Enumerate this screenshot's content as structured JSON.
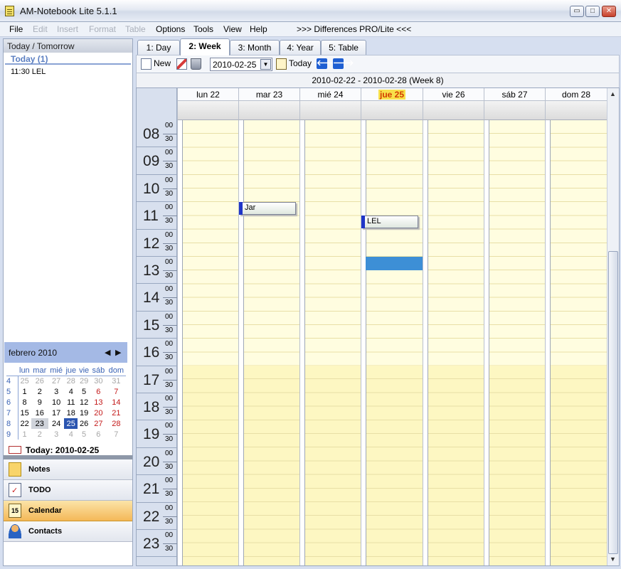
{
  "window": {
    "title": "AM-Notebook Lite  5.1.1",
    "minimize": "▭",
    "maximize": "□",
    "close": "✕"
  },
  "menu": [
    "File",
    "Edit",
    "Insert",
    "Format",
    "Table",
    "Options",
    "Tools",
    "View",
    "Help",
    ">>> Differences PRO/Lite <<<"
  ],
  "left": {
    "header": "Today / Tomorrow",
    "today_label": "Today (1)",
    "items": [
      "11:30 LEL"
    ],
    "minical": {
      "month": "febrero 2010",
      "prev": "◀",
      "next": "▶",
      "dow": [
        "lun",
        "mar",
        "mié",
        "jue",
        "vie",
        "sáb",
        "dom"
      ],
      "weeks": [
        {
          "wk": "4",
          "days": [
            "25",
            "26",
            "27",
            "28",
            "29",
            "30",
            "31"
          ]
        },
        {
          "wk": "5",
          "days": [
            "1",
            "2",
            "3",
            "4",
            "5",
            "6",
            "7"
          ]
        },
        {
          "wk": "6",
          "days": [
            "8",
            "9",
            "10",
            "11",
            "12",
            "13",
            "14"
          ]
        },
        {
          "wk": "7",
          "days": [
            "15",
            "16",
            "17",
            "18",
            "19",
            "20",
            "21"
          ]
        },
        {
          "wk": "8",
          "days": [
            "22",
            "23",
            "24",
            "25",
            "26",
            "27",
            "28"
          ]
        },
        {
          "wk": "9",
          "days": [
            "1",
            "2",
            "3",
            "4",
            "5",
            "6",
            "7"
          ]
        }
      ],
      "today_text": "Today: 2010-02-25"
    },
    "splitter_dots": "•••••",
    "nav": [
      {
        "label": "Notes",
        "icon": "notes-icon"
      },
      {
        "label": "TODO",
        "icon": "todo-icon"
      },
      {
        "label": "Calendar",
        "icon": "calendar-icon",
        "icon_text": "15"
      },
      {
        "label": "Contacts",
        "icon": "contacts-icon"
      }
    ]
  },
  "tabs": [
    "1: Day",
    "2: Week",
    "3: Month",
    "4: Year",
    "5: Table"
  ],
  "active_tab": "2: Week",
  "toolbar": {
    "new_label": "New",
    "date_value": "2010-02-25",
    "dropdown": "▼",
    "today_label": "Today",
    "prev": "🡐",
    "next": "🡒"
  },
  "week_title": "2010-02-22  -  2010-02-28  (Week 8)",
  "days": [
    "lun 22",
    "mar 23",
    "mié 24",
    "jue 25",
    "vie 26",
    "sáb 27",
    "dom 28"
  ],
  "today_day": "jue 25",
  "hours": [
    "08",
    "09",
    "10",
    "11",
    "12",
    "13",
    "14",
    "15",
    "16",
    "17",
    "18",
    "19",
    "20",
    "21",
    "22",
    "23"
  ],
  "minutes": [
    "00",
    "30"
  ],
  "events": [
    {
      "title": "Jar",
      "day": "mar 23",
      "start": "11:00"
    },
    {
      "title": "LEL",
      "day": "jue 25",
      "start": "11:30"
    }
  ],
  "selection": {
    "day": "jue 25",
    "start": "13:00",
    "end": "13:30"
  },
  "colors": {
    "today_highlight": "#f8e04a",
    "event_marker": "#1f35c8",
    "selection": "#3d8fd6",
    "active_nav": "#f4b858"
  }
}
